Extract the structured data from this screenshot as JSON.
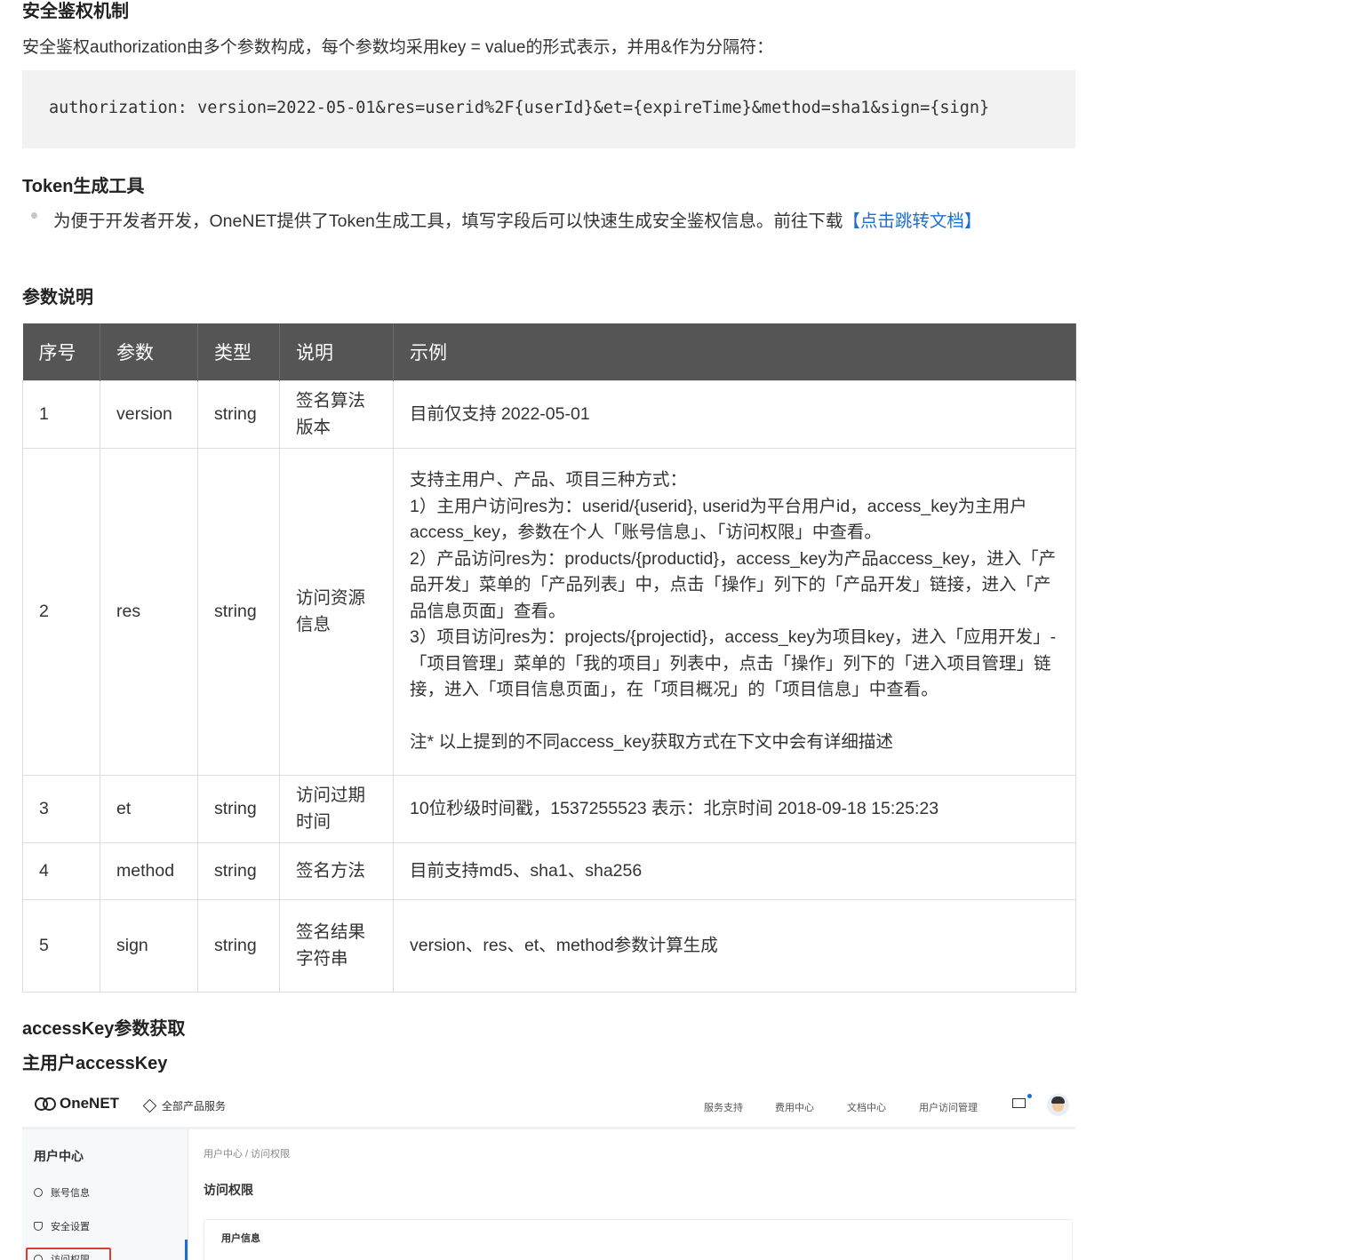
{
  "sections": {
    "security_title": "安全鉴权机制",
    "security_intro": "安全鉴权authorization由多个参数构成，每个参数均采用key = value的形式表示，并用&作为分隔符：",
    "code_sample": "authorization: version=2022-05-01&res=userid%2F{userId}&et={expireTime}&method=sha1&sign={sign}",
    "token_title": "Token生成工具",
    "token_text": "为便于开发者开发，OneNET提供了Token生成工具，填写字段后可以快速生成安全鉴权信息。前往下载",
    "token_link": "【点击跳转文档】",
    "params_title": "参数说明",
    "access_title": "accessKey参数获取",
    "main_user_title": "主用户accessKey"
  },
  "table": {
    "headers": [
      "序号",
      "参数",
      "类型",
      "说明",
      "示例"
    ],
    "rows": [
      {
        "no": "1",
        "param": "version",
        "type": "string",
        "desc": "签名算法版本",
        "example": "目前仅支持 2022-05-01"
      },
      {
        "no": "2",
        "param": "res",
        "type": "string",
        "desc": "访问资源信息",
        "example": "支持主用户、产品、项目三种方式：\n1）主用户访问res为：userid/{userid}, userid为平台用户id，access_key为主用户access_key，参数在个人「账号信息」、「访问权限」中查看。\n2）产品访问res为：products/{productid}，access_key为产品access_key，进入「产品开发」菜单的「产品列表」中，点击「操作」列下的「产品开发」链接，进入「产品信息页面」查看。\n3）项目访问res为：projects/{projectid}，access_key为项目key，进入「应用开发」-「项目管理」菜单的「我的项目」列表中，点击「操作」列下的「进入项目管理」链接，进入「项目信息页面」，在「项目概况」的「项目信息」中查看。\n\n   注* 以上提到的不同access_key获取方式在下文中会有详细描述"
      },
      {
        "no": "3",
        "param": "et",
        "type": "string",
        "desc": "访问过期时间",
        "example": "10位秒级时间戳，1537255523 表示：北京时间 2018-09-18 15:25:23"
      },
      {
        "no": "4",
        "param": "method",
        "type": "string",
        "desc": "签名方法",
        "example": "目前支持md5、sha1、sha256"
      },
      {
        "no": "5",
        "param": "sign",
        "type": "string",
        "desc": "签名结果字符串",
        "example": "version、res、et、method参数计算生成"
      }
    ]
  },
  "screenshot": {
    "logo": "OneNET",
    "all_products": "全部产品服务",
    "nav": [
      "服务支持",
      "费用中心",
      "文档中心",
      "用户访问管理"
    ],
    "sidebar_title": "用户中心",
    "sidebar_items": [
      "账号信息",
      "安全设置",
      "访问权限"
    ],
    "breadcrumb": "用户中心 / 访问权限",
    "page_title": "访问权限",
    "card_title": "用户信息",
    "active_color": "#e23b2e",
    "brand_color": "#1a6fd4"
  }
}
